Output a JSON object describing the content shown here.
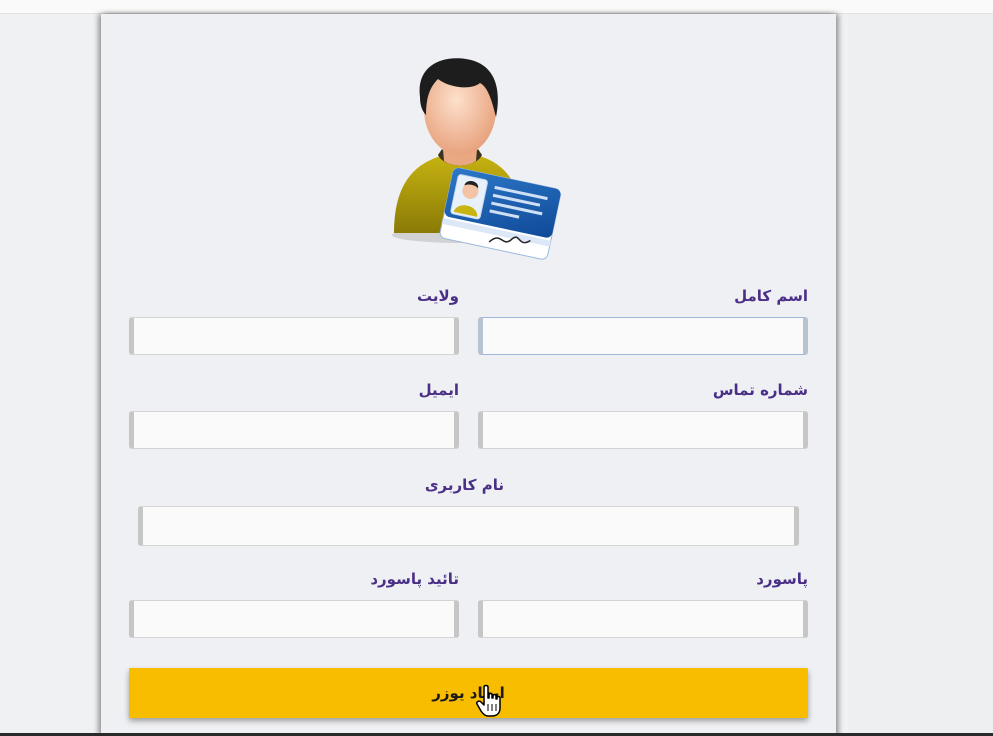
{
  "form": {
    "fields": {
      "full_name": {
        "label": "اسم کامل",
        "value": ""
      },
      "province": {
        "label": "ولایت",
        "value": ""
      },
      "phone": {
        "label": "شماره تماس",
        "value": ""
      },
      "email": {
        "label": "ایمیل",
        "value": ""
      },
      "username": {
        "label": "نام کاربری",
        "value": ""
      },
      "password": {
        "label": "پاسورد",
        "value": ""
      },
      "confirm_password": {
        "label": "تائید پاسورد",
        "value": ""
      }
    },
    "submit_label": "ایجاد یوزر"
  },
  "icons": {
    "header": "user-id-card-icon",
    "cursor": "hand-pointer-icon"
  },
  "colors": {
    "label": "#4a2f86",
    "button": "#f9bd00",
    "card": "#eff0f3"
  }
}
